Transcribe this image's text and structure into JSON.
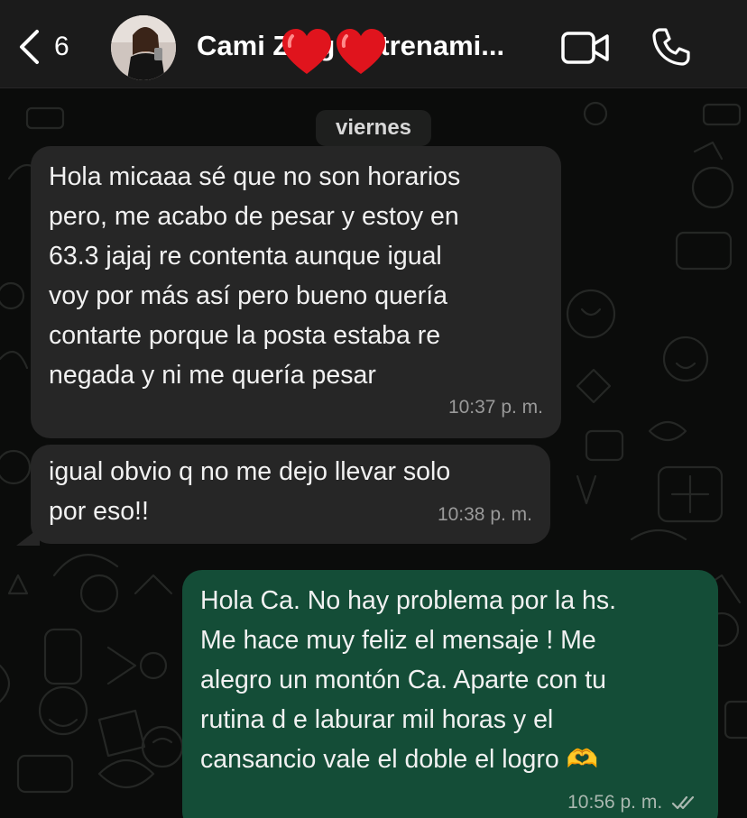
{
  "header": {
    "back_count": "6",
    "contact_name": "Cami Zúñiga Entrenamiento",
    "contact_name_display": "Cami Z     g     ntrenami...",
    "icons": [
      "back-chevron-icon",
      "avatar",
      "heart-sticker-icon",
      "video-call-icon",
      "phone-icon"
    ]
  },
  "chat": {
    "day_label": "viernes",
    "messages": [
      {
        "direction": "incoming",
        "lines": [
          "Hola micaaa sé que no son horarios",
          "pero, me acabo de pesar y estoy en",
          "63.3 jajaj re contenta aunque igual",
          "voy  por más así pero bueno quería",
          "contarte porque la posta estaba re",
          "negada y ni me quería pesar"
        ],
        "time": "10:37 p. m."
      },
      {
        "direction": "incoming",
        "lines": [
          "igual obvio q no me dejo llevar solo",
          "por eso!!"
        ],
        "time": "10:38 p. m."
      },
      {
        "direction": "outgoing",
        "lines": [
          "Hola Ca. No hay problema por la hs.",
          "Me hace muy feliz el mensaje ! Me",
          "alegro un montón Ca. Aparte con tu",
          "rutina d e laburar mil horas y el",
          "cansancio vale el doble el logro 🫶"
        ],
        "time": "10:56 p. m.",
        "status": "read"
      }
    ]
  },
  "colors": {
    "header_bg": "#1b1b1b",
    "chat_bg": "#0b0c0b",
    "incoming_bubble": "#262626",
    "outgoing_bubble": "#144d37",
    "read_check": "#aab8b0",
    "heart": "#e0141d"
  }
}
